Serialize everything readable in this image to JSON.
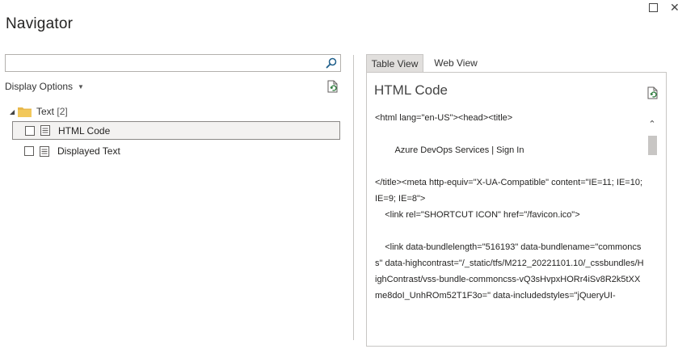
{
  "window": {
    "title": "Navigator",
    "maximize_icon": "maximize-icon",
    "close_icon": "close-icon"
  },
  "left_panel": {
    "search": {
      "value": "",
      "placeholder": "",
      "icon": "search-icon"
    },
    "display_options": {
      "label": "Display Options",
      "icon": "chevron-down-icon"
    },
    "refresh_icon": "refresh-icon",
    "tree": {
      "folder": {
        "label": "Text",
        "count": "[2]",
        "icon": "folder-icon",
        "expanded": true
      },
      "items": [
        {
          "label": "HTML Code",
          "checked": false,
          "selected": true,
          "icon": "table-icon"
        },
        {
          "label": "Displayed Text",
          "checked": false,
          "selected": false,
          "icon": "table-icon"
        }
      ]
    }
  },
  "right_panel": {
    "tabs": [
      {
        "label": "Table View",
        "active": true
      },
      {
        "label": "Web View",
        "active": false
      }
    ],
    "preview": {
      "title": "HTML Code",
      "refresh_icon": "refresh-icon",
      "content": "<html lang=\"en-US\"><head><title>\n\n        Azure DevOps Services | Sign In\n\n</title><meta http-equiv=\"X-UA-Compatible\" content=\"IE=11; IE=10; IE=9; IE=8\">\n    <link rel=\"SHORTCUT ICON\" href=\"/favicon.ico\">\n\n    <link data-bundlelength=\"516193\" data-bundlename=\"commoncss\" data-highcontrast=\"/_static/tfs/M212_20221101.10/_cssbundles/HighContrast/vss-bundle-commoncss-vQ3sHvpxHORr4iSv8R2k5tXXme8doI_UnhROm52T1F3o=\" data-includedstyles=\"jQueryUI-\n    "
    }
  },
  "colors": {
    "folder": "#e8b84b",
    "selected_row_bg": "#f3f2f1",
    "active_tab_bg": "#e1dfdd",
    "border": "#c8c6c4"
  }
}
